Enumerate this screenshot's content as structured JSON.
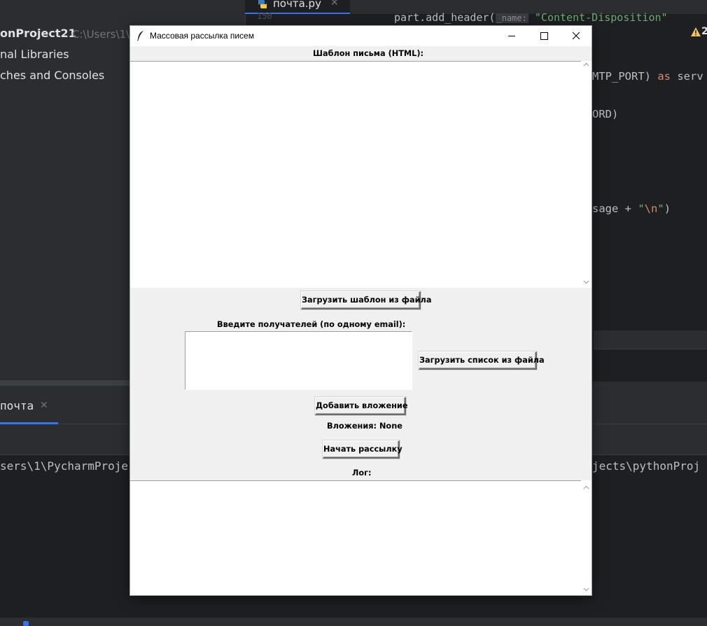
{
  "ide": {
    "file_tab": {
      "label": "почта.py",
      "line_number": "150"
    },
    "code_top": {
      "prefix": "part.add_header(",
      "hint": "_name:",
      "string": "\"Content-Disposition\""
    },
    "project": {
      "name": "onProject21",
      "path": "C:\\Users\\1\\"
    },
    "tree_items": [
      "nal Libraries",
      "ches and Consoles"
    ],
    "warning_count": "2",
    "code_lines": {
      "smtp": {
        "text": "MTP_PORT) ",
        "kw": "as",
        "rest": " serv"
      },
      "ord": "ORD)",
      "message": {
        "text": "sage + ",
        "str_open": "\"",
        "esc": "\\n",
        "str_close": "\"",
        "close": ")"
      }
    },
    "run_tab": "почта",
    "console": {
      "left": "sers\\1\\PycharmProje",
      "right": "jects\\pythonProj"
    }
  },
  "window": {
    "title": "Массовая рассылка писем",
    "template_label": "Шаблон письма (HTML):",
    "template_value": "",
    "load_template_button": "Загрузить шаблон из файла",
    "recipients_label": "Введите получателей (по одному email):",
    "recipients_value": "",
    "load_list_button": "Загрузить список из файла",
    "add_attachment_button": "Добавить вложение",
    "attachments_text": "Вложения: None",
    "start_button": "Начать рассылку",
    "log_label": "Лог:",
    "log_value": ""
  }
}
